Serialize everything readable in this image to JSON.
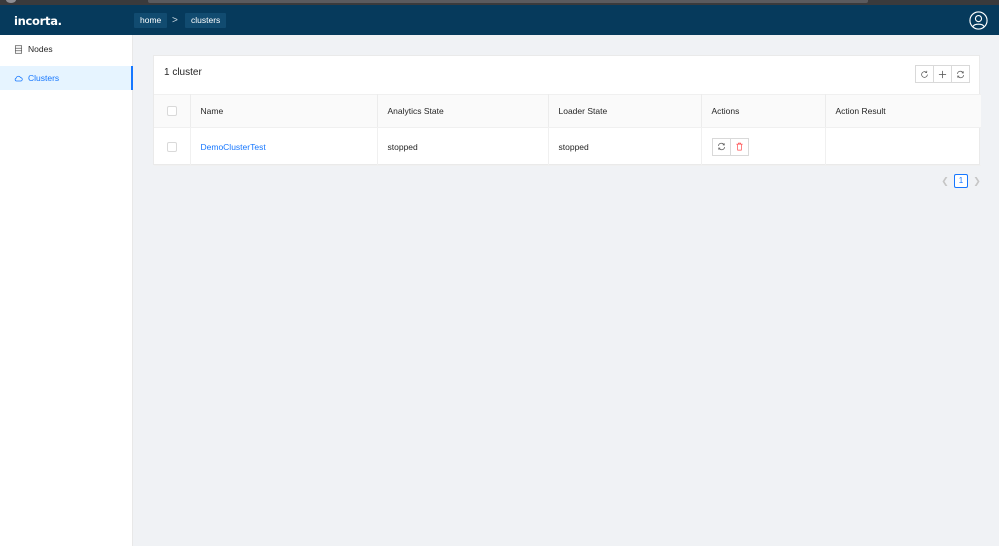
{
  "app": {
    "logo": "incorta."
  },
  "breadcrumb": {
    "items": [
      "home",
      "clusters"
    ],
    "separator": ">"
  },
  "sidebar": {
    "items": [
      {
        "label": "Nodes",
        "icon": "server-icon",
        "active": false
      },
      {
        "label": "Clusters",
        "icon": "cloud-icon",
        "active": true
      }
    ]
  },
  "main": {
    "title": "1 cluster",
    "toolbar": [
      "reload-icon",
      "plus-icon",
      "sync-icon"
    ],
    "table": {
      "columns": [
        "Name",
        "Analytics State",
        "Loader State",
        "Actions",
        "Action Result"
      ],
      "rows": [
        {
          "name": "DemoClusterTest",
          "analytics_state": "stopped",
          "loader_state": "stopped",
          "action_result": ""
        }
      ]
    },
    "pagination": {
      "current": "1"
    }
  },
  "colors": {
    "header": "#063a5c",
    "accent": "#1677ff",
    "danger": "#ff4d4f"
  }
}
